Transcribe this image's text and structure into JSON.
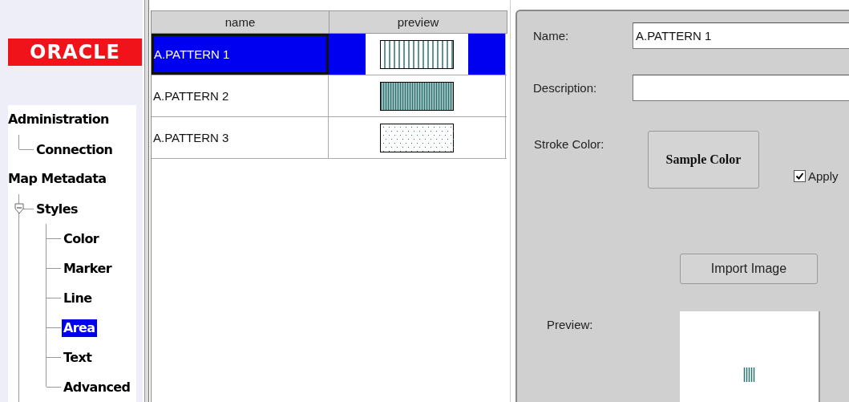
{
  "sidebar": {
    "logo": "ORACLE",
    "tree": [
      {
        "label": "Administration",
        "selected": false,
        "children": [
          {
            "label": "Connection",
            "selected": false
          }
        ]
      },
      {
        "label": "Map Metadata",
        "selected": false,
        "children": [
          {
            "label": "Styles",
            "selected": false,
            "expanded": true,
            "children": [
              {
                "label": "Color",
                "selected": false
              },
              {
                "label": "Marker",
                "selected": false
              },
              {
                "label": "Line",
                "selected": false
              },
              {
                "label": "Area",
                "selected": true
              },
              {
                "label": "Text",
                "selected": false
              },
              {
                "label": "Advanced",
                "selected": false
              }
            ]
          }
        ]
      }
    ]
  },
  "table": {
    "columns": [
      "name",
      "preview"
    ],
    "rows": [
      {
        "name": "A.PATTERN 1",
        "kind": "sparse",
        "selected": true
      },
      {
        "name": "A.PATTERN 2",
        "kind": "dense",
        "selected": false
      },
      {
        "name": "A.PATTERN 3",
        "kind": "dots",
        "selected": false
      }
    ]
  },
  "form": {
    "name": {
      "label": "Name:",
      "value": "A.PATTERN 1"
    },
    "description": {
      "label": "Description:"
    },
    "stroke_color": {
      "label": "Stroke Color:",
      "button": "Sample Color"
    },
    "apply": {
      "label": "Apply",
      "checked": true
    },
    "import_button": {
      "label": "Import Image"
    },
    "preview": {
      "label": "Preview:"
    }
  }
}
